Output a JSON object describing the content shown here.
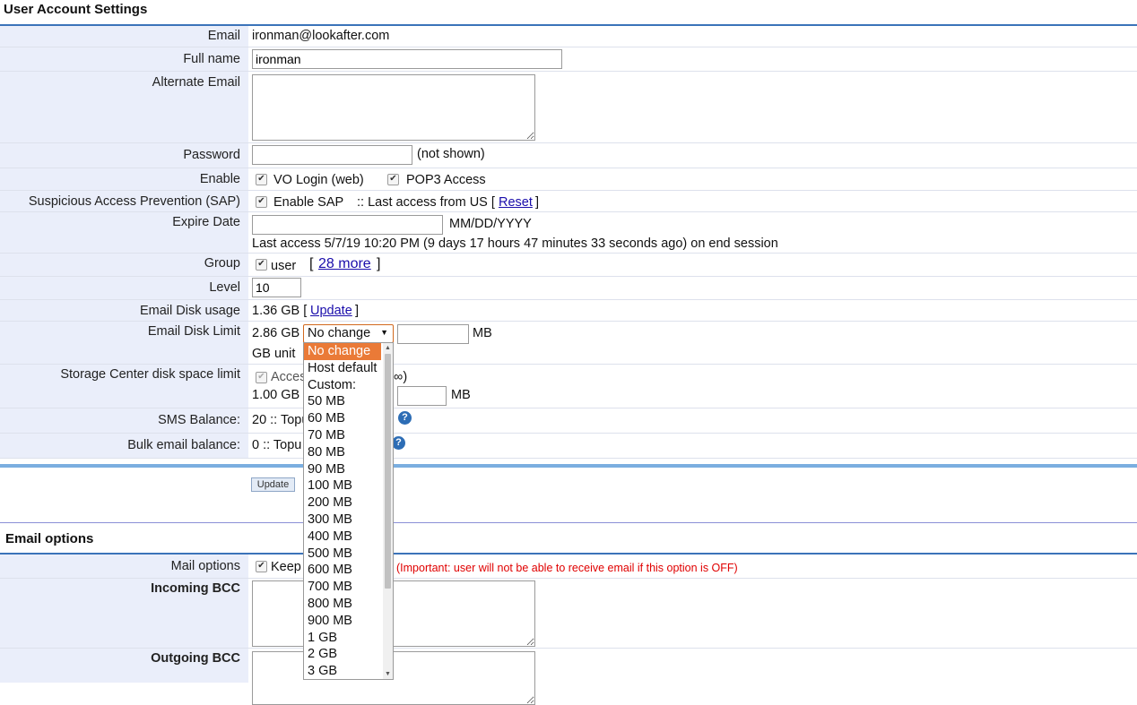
{
  "header": {
    "title": "User Account Settings"
  },
  "email": {
    "label": "Email",
    "value": "ironman@lookafter.com"
  },
  "full_name": {
    "label": "Full name",
    "value": "ironman"
  },
  "alternate_email": {
    "label": "Alternate Email",
    "value": ""
  },
  "password": {
    "label": "Password",
    "note": "(not shown)"
  },
  "enable": {
    "label": "Enable",
    "vo_login": "VO Login (web)",
    "pop3": "POP3 Access"
  },
  "sap": {
    "label": "Suspicious Access Prevention (SAP)",
    "enable": "Enable SAP",
    "last_access": ":: Last access from US [",
    "reset": "Reset",
    "close": "]"
  },
  "expire": {
    "label": "Expire Date",
    "format": "MM/DD/YYYY",
    "last_access": "Last access 5/7/19 10:20 PM (9 days 17 hours 47 minutes 33 seconds ago) on end session"
  },
  "group": {
    "label": "Group",
    "user": "user",
    "open": "[",
    "more": "28 more",
    "close": "]"
  },
  "level": {
    "label": "Level",
    "value": "10"
  },
  "disk_usage": {
    "label": "Email Disk usage",
    "value": "1.36 GB [",
    "update": "Update",
    "close": "]"
  },
  "disk_limit": {
    "label": "Email Disk Limit",
    "value": "2.86 GB",
    "selected": "No change",
    "unit": "MB",
    "gb_unit": "GB unit",
    "options": [
      "No change",
      "Host default",
      "Custom:",
      "50 MB",
      "60 MB",
      "70 MB",
      "80 MB",
      "90 MB",
      "100 MB",
      "200 MB",
      "300 MB",
      "400 MB",
      "500 MB",
      "600 MB",
      "700 MB",
      "800 MB",
      "900 MB",
      "1 GB",
      "2 GB",
      "3 GB"
    ]
  },
  "storage": {
    "label": "Storage Center disk space limit",
    "access_partial": "Acces",
    "paren_partial": "∞)",
    "value": "1.00 GB",
    "unit": "MB"
  },
  "sms": {
    "label": "SMS Balance:",
    "value": "20 :: Topu"
  },
  "bulk": {
    "label": "Bulk email balance:",
    "value": "0 :: Topu"
  },
  "update_button": "Update",
  "email_options": {
    "title": "Email options",
    "mail_options": {
      "label": "Mail options",
      "keep": "Keep",
      "warning": "(Important: user will not be able to receive email if this option is OFF)"
    },
    "incoming_bcc": {
      "label": "Incoming BCC"
    },
    "outgoing_bcc": {
      "label": "Outgoing BCC"
    }
  },
  "colors": {
    "accent": "#3b73b9",
    "label_bg": "#eaeefa",
    "selected_option": "#ea7a37",
    "warning": "#e00000"
  }
}
